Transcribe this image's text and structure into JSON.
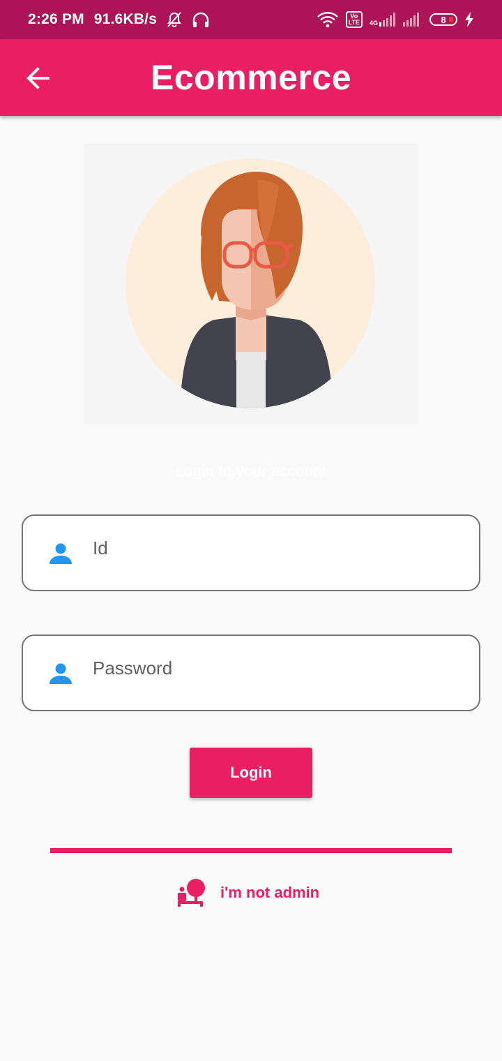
{
  "status_bar": {
    "time": "2:26 PM",
    "speed": "91.6KB/s",
    "volte_line1": "Vo",
    "volte_line2": "LTE",
    "network": "4G",
    "battery": "8"
  },
  "app_bar": {
    "title": "Ecommerce",
    "back_icon": "arrow-left-icon"
  },
  "subtitle": "Login to your account",
  "form": {
    "id_field": {
      "placeholder": "Id",
      "value": "",
      "icon": "person-icon"
    },
    "password_field": {
      "placeholder": "Password",
      "value": "",
      "icon": "person-icon"
    },
    "login_label": "Login"
  },
  "not_admin": {
    "label": "i'm not admin",
    "icon": "user-desk-icon"
  },
  "colors": {
    "primary": "#e91e63",
    "status_bar": "#ad1457",
    "icon_blue": "#2196f3",
    "background": "#fafafa"
  }
}
